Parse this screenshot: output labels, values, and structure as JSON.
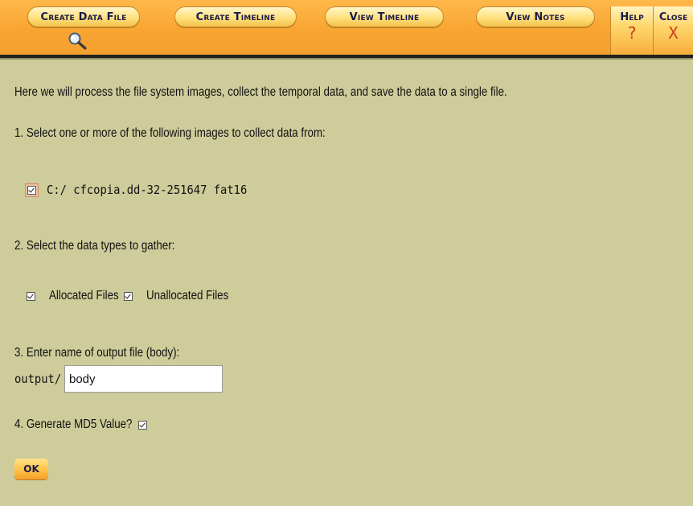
{
  "toolbar": {
    "tabs": [
      {
        "label": "Create Data File"
      },
      {
        "label": "Create Timeline"
      },
      {
        "label": "View Timeline"
      },
      {
        "label": "View Notes"
      }
    ],
    "help": {
      "label": "Help",
      "glyph": "?"
    },
    "close": {
      "label": "Close",
      "glyph": "X"
    },
    "active_icon": "search-icon"
  },
  "intro": "Here we will process the file system images, collect the temporal data, and save the data to a single file.",
  "step1": {
    "label": "1. Select one or more of the following images to collect data from:",
    "images": [
      {
        "text": "C:/ cfcopia.dd-32-251647 fat16",
        "checked": true
      }
    ]
  },
  "step2": {
    "label": "2. Select the data types to gather:",
    "types": [
      {
        "text": "Allocated Files",
        "checked": true
      },
      {
        "text": "Unallocated Files",
        "checked": true
      }
    ]
  },
  "step3": {
    "label": "3. Enter name of output file (body):",
    "prefix": "output/",
    "value": "body"
  },
  "step4": {
    "label": "4. Generate MD5 Value?",
    "checked": true
  },
  "ok_label": "OK",
  "colors": {
    "background": "#cdcc9a",
    "toolbar": "#f8a532",
    "tab": "#ffe07e",
    "tab_text": "#1a1a4a",
    "glyph": "#c8401a"
  }
}
